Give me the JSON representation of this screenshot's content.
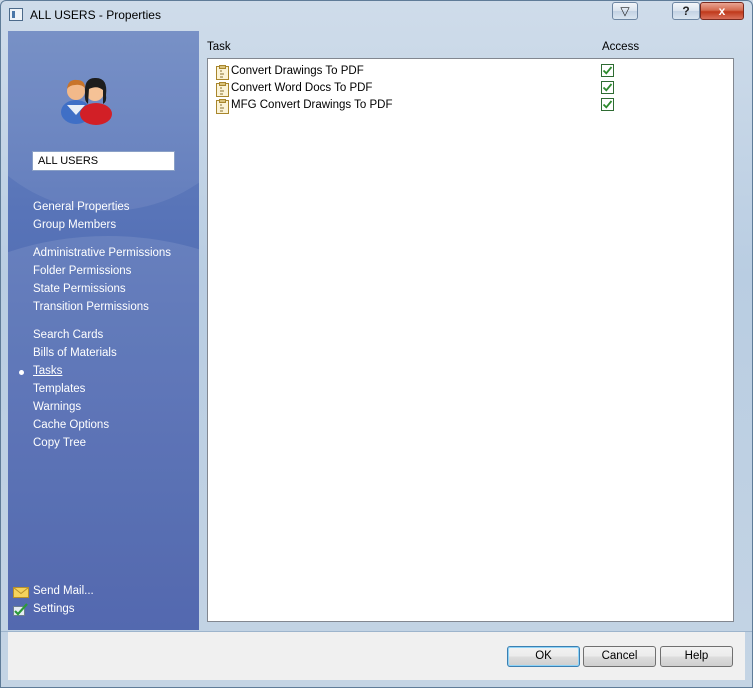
{
  "window": {
    "title": "ALL USERS - Properties",
    "help_glyph": "?",
    "close_glyph": "x",
    "dropdown_glyph": "▽"
  },
  "sidebar": {
    "name_value": "ALL USERS",
    "groups": [
      [
        "General Properties",
        "Group Members"
      ],
      [
        "Administrative Permissions",
        "Folder Permissions",
        "State Permissions",
        "Transition Permissions"
      ],
      [
        "Search Cards",
        "Bills of Materials",
        "Tasks",
        "Templates",
        "Warnings",
        "Cache Options",
        "Copy Tree"
      ]
    ],
    "items": [
      {
        "label": "General Properties"
      },
      {
        "label": "Group Members"
      },
      {
        "label": "Administrative Permissions"
      },
      {
        "label": "Folder Permissions"
      },
      {
        "label": "State Permissions"
      },
      {
        "label": "Transition Permissions"
      },
      {
        "label": "Search Cards"
      },
      {
        "label": "Bills of Materials"
      },
      {
        "label": "Tasks",
        "active": true
      },
      {
        "label": "Templates"
      },
      {
        "label": "Warnings"
      },
      {
        "label": "Cache Options"
      },
      {
        "label": "Copy Tree"
      }
    ],
    "bottom_links": [
      {
        "label": "Send Mail...",
        "icon": "envelope-icon"
      },
      {
        "label": "Settings",
        "icon": "settings-check-icon"
      }
    ]
  },
  "task_list": {
    "columns": [
      "Task",
      "Access"
    ],
    "rows": [
      {
        "task": "Convert Drawings To PDF",
        "access": true
      },
      {
        "task": "Convert Word Docs To PDF",
        "access": true
      },
      {
        "task": "MFG Convert Drawings To PDF",
        "access": true
      }
    ]
  },
  "buttons": {
    "ok": "OK",
    "cancel": "Cancel",
    "help": "Help"
  },
  "colors": {
    "sidebar_top": "#6d88c2",
    "sidebar_bottom": "#4058a6",
    "checkmark": "#2e8b2e",
    "close_button": "#c0391b"
  }
}
